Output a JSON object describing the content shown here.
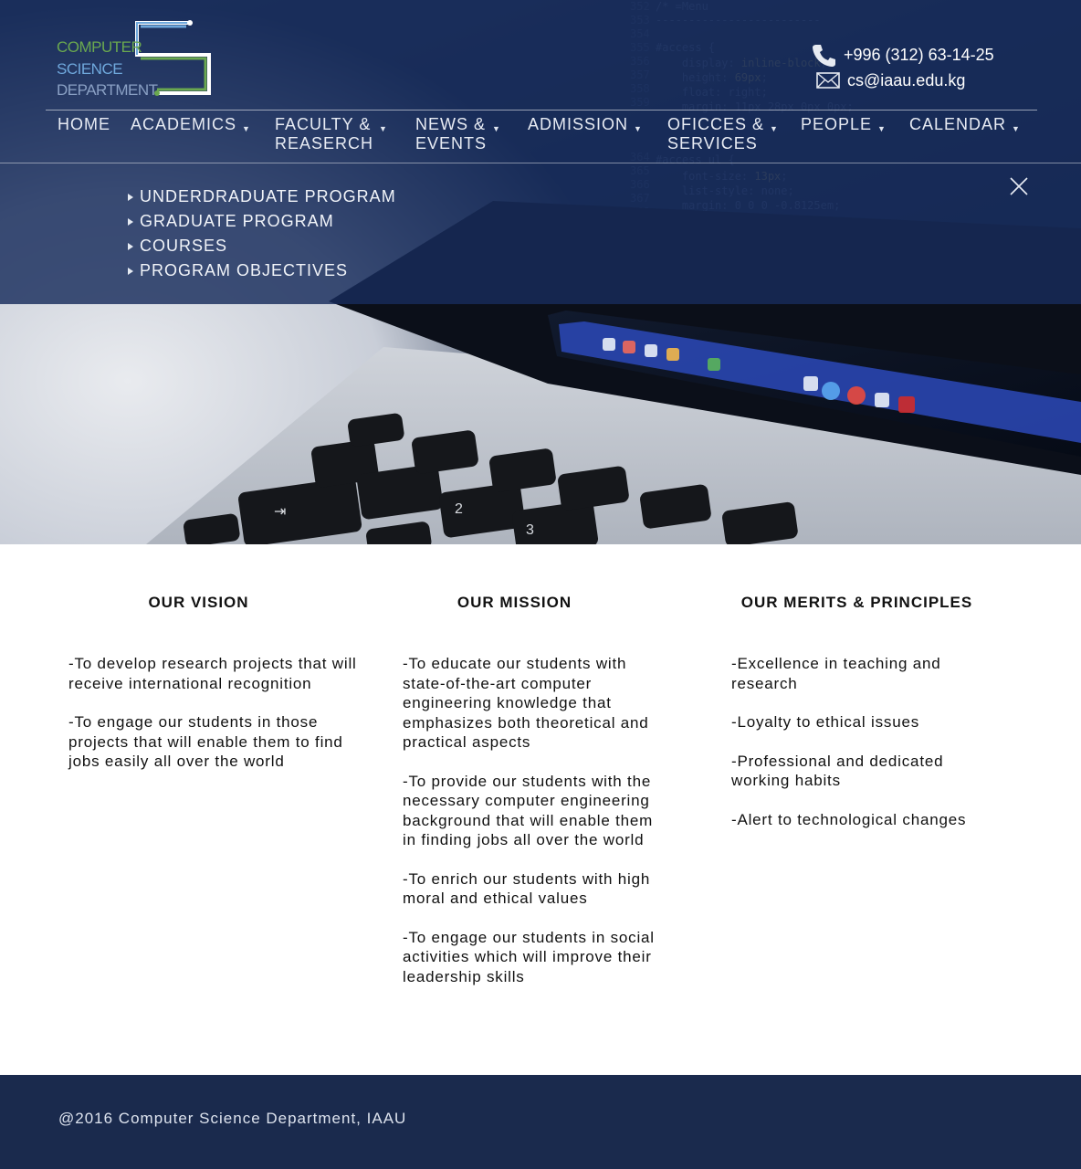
{
  "logo": {
    "line1": "COMPUTER",
    "line2": "SCIENCE",
    "line3": "DEPARTMENT"
  },
  "contact": {
    "phone": "+996 (312) 63-14-25",
    "email": "cs@iaau.edu.kg"
  },
  "nav": {
    "home": "HOME",
    "academics": "ACADEMICS",
    "faculty_1": "FACULTY &",
    "faculty_2": "REASERCH",
    "news_1": "NEWS &",
    "news_2": "EVENTS",
    "admission": "ADMISSION",
    "offices_1": "OFICCES &",
    "offices_2": "SERVICES",
    "people": "PEOPLE",
    "calendar": "CALENDAR"
  },
  "dropdown": {
    "items": [
      "UNDERDRADUATE PROGRAM",
      "GRADUATE PROGRAM",
      "COURSES",
      "PROGRAM OBJECTIVES"
    ]
  },
  "vision": {
    "title": "OUR VISION",
    "items": [
      "-To develop research projects that will receive international recognition",
      "-To engage our students in those projects that will enable them to find jobs easily all over the world"
    ]
  },
  "mission": {
    "title": "OUR MISSION",
    "items": [
      "-To educate our students with state-of-the-art computer engineering knowledge that emphasizes both theoretical and practical aspects",
      "-To provide our students with the necessary computer engineering background that will enable them in finding jobs all over the world",
      "-To enrich our students with high moral and ethical values",
      "-To engage our students in social activities which will improve their leadership skills"
    ]
  },
  "merits": {
    "title": "OUR MERITS & PRINCIPLES",
    "items": [
      "-Excellence in teaching and research",
      "-Loyalty to ethical issues",
      "-Professional and dedicated working habits",
      "-Alert to technological changes"
    ]
  },
  "footer": {
    "text": "@2016 Computer Science Department, IAAU"
  }
}
